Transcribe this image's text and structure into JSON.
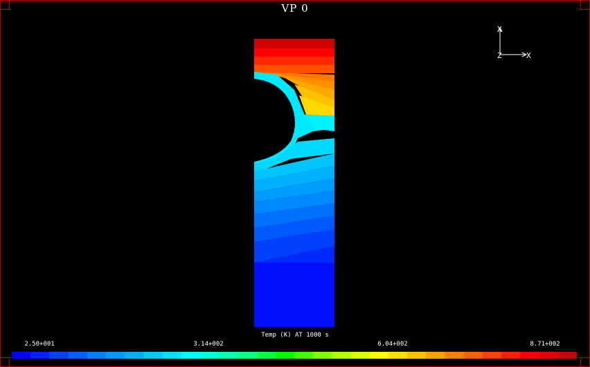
{
  "viewport": {
    "title": "VP 0"
  },
  "triad": {
    "up_label": "X",
    "right_label": "X",
    "origin_label": "Z"
  },
  "legend": {
    "title": "Temp (K) AT 1000 s",
    "ticks": [
      "2.50+001",
      "3.14+002",
      "6.04+002",
      "8.71+002"
    ],
    "min": 25,
    "max": 871,
    "colors": [
      "#0000ff",
      "#0020ff",
      "#0040ff",
      "#0060ff",
      "#0080ff",
      "#0098ff",
      "#00b0ff",
      "#00c8ff",
      "#00e0ff",
      "#00f8ff",
      "#00ffd8",
      "#00ffb0",
      "#00ff80",
      "#00ff40",
      "#00ff00",
      "#40ff00",
      "#80ff00",
      "#b0ff00",
      "#d8ff00",
      "#ffff00",
      "#ffe000",
      "#ffc000",
      "#ffa000",
      "#ff8000",
      "#ff6000",
      "#ff4000",
      "#ff2000",
      "#ff0000",
      "#e00000",
      "#c80000"
    ]
  }
}
